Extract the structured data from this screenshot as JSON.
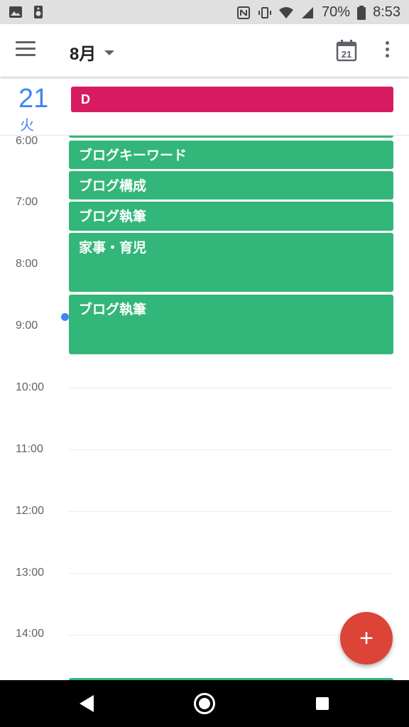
{
  "status_bar": {
    "battery": "70%",
    "time": "8:53",
    "icons": [
      "image-icon",
      "speaker-icon",
      "nfc-icon",
      "vibrate-icon",
      "wifi-icon",
      "signal-icon",
      "battery-icon"
    ]
  },
  "app_bar": {
    "month": "8月",
    "today_number": "21"
  },
  "day": {
    "number": "21",
    "weekday": "火",
    "all_day_event": "D"
  },
  "hours": [
    "6:00",
    "7:00",
    "8:00",
    "9:00",
    "10:00",
    "11:00",
    "12:00",
    "13:00",
    "14:00"
  ],
  "events": [
    {
      "title": "ブログキーワード"
    },
    {
      "title": "ブログ構成"
    },
    {
      "title": "ブログ執筆"
    },
    {
      "title": "家事・育児"
    },
    {
      "title": "ブログ執筆"
    }
  ],
  "fab": {
    "label": "+"
  },
  "colors": {
    "accent": "#4285f4",
    "event_green": "#33b679",
    "all_day_pink": "#d81b60",
    "fab_red": "#db4437"
  }
}
